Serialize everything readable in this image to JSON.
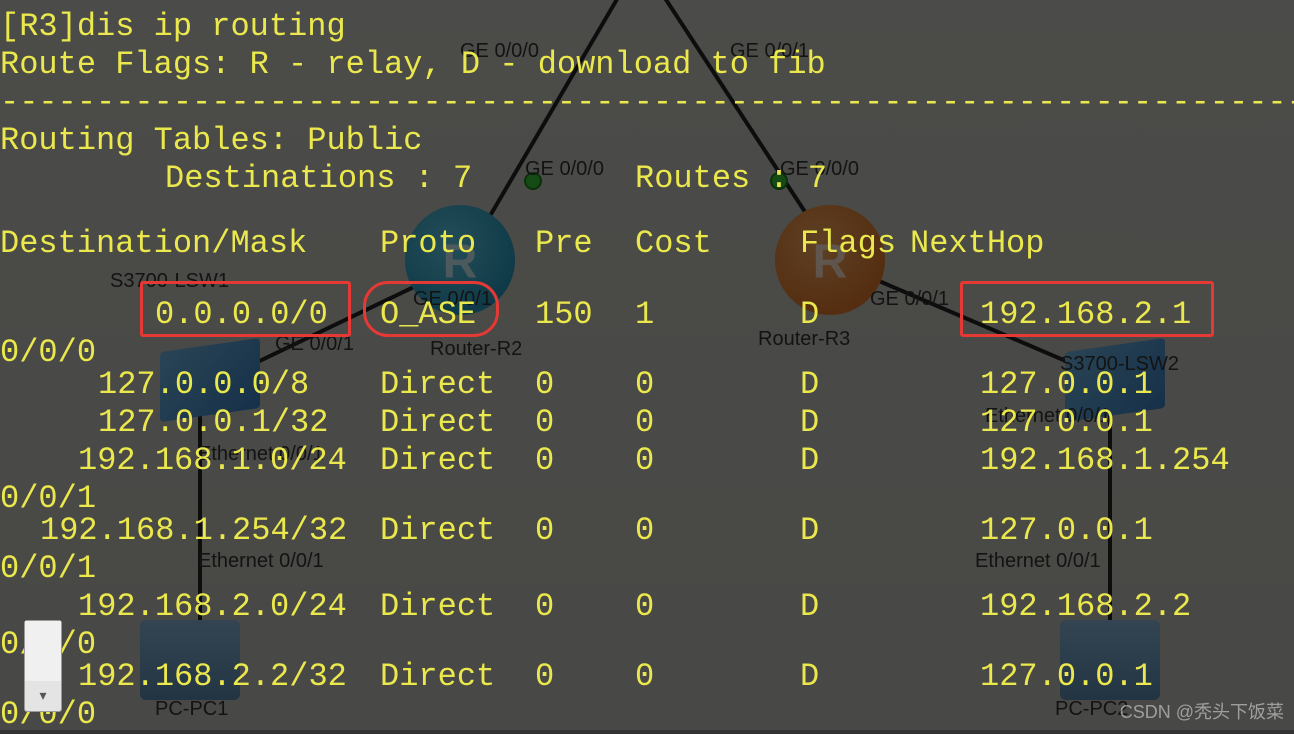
{
  "terminal": {
    "prompt": "[R3]dis ip routing",
    "route_flags": "Route Flags: R - relay, D - download to fib",
    "tables_header": "Routing Tables: Public",
    "dest_count_label": "Destinations : 7",
    "routes_count_label": "Routes : 7",
    "columns": {
      "dest": "Destination/Mask",
      "proto": "Proto",
      "pre": "Pre",
      "cost": "Cost",
      "flags": "Flags",
      "nexthop": "NextHop"
    },
    "rows": [
      {
        "dest": "0.0.0.0/0",
        "proto": "O_ASE",
        "pre": "150",
        "cost": "1",
        "flags": "D",
        "nexthop": "192.168.2.1",
        "iface": "0/0/0"
      },
      {
        "dest": "127.0.0.0/8",
        "proto": "Direct",
        "pre": "0",
        "cost": "0",
        "flags": "D",
        "nexthop": "127.0.0.1",
        "iface": ""
      },
      {
        "dest": "127.0.0.1/32",
        "proto": "Direct",
        "pre": "0",
        "cost": "0",
        "flags": "D",
        "nexthop": "127.0.0.1",
        "iface": ""
      },
      {
        "dest": "192.168.1.0/24",
        "proto": "Direct",
        "pre": "0",
        "cost": "0",
        "flags": "D",
        "nexthop": "192.168.1.254",
        "iface": "0/0/1"
      },
      {
        "dest": "192.168.1.254/32",
        "proto": "Direct",
        "pre": "0",
        "cost": "0",
        "flags": "D",
        "nexthop": "127.0.0.1",
        "iface": "0/0/1"
      },
      {
        "dest": "192.168.2.0/24",
        "proto": "Direct",
        "pre": "0",
        "cost": "0",
        "flags": "D",
        "nexthop": "192.168.2.2",
        "iface": "0/0/0"
      },
      {
        "dest": "192.168.2.2/32",
        "proto": "Direct",
        "pre": "0",
        "cost": "0",
        "flags": "D",
        "nexthop": "127.0.0.1",
        "iface": "0/0/0"
      }
    ]
  },
  "topology": {
    "labels": {
      "ge000_top": "GE 0/0/0",
      "ge001_top": "GE 0/0/1",
      "ge000_midL": "GE 0/0/0",
      "ge000_midR": "GE 0/0/0",
      "ge001_r2": "GE 0/0/1",
      "ge001_r3": "GE 0/0/1",
      "ge001_sw1": "GE 0/0/1",
      "s3700_lsw1": "S3700-LSW1",
      "s3700_lsw2": "S3700-LSW2",
      "router_r2": "Router-R2",
      "router_r3": "Router-R3",
      "eth001_l1": "Ethernet 0/0/1",
      "eth001_r1": "Ethernet 0/0/1",
      "eth001_l2": "Ethernet 0/0/1",
      "eth001_r2": "Ethernet 0/0/1",
      "pc1": "PC-PC1",
      "pc2": "PC-PC2"
    }
  },
  "watermark": "CSDN @秃头下饭菜"
}
